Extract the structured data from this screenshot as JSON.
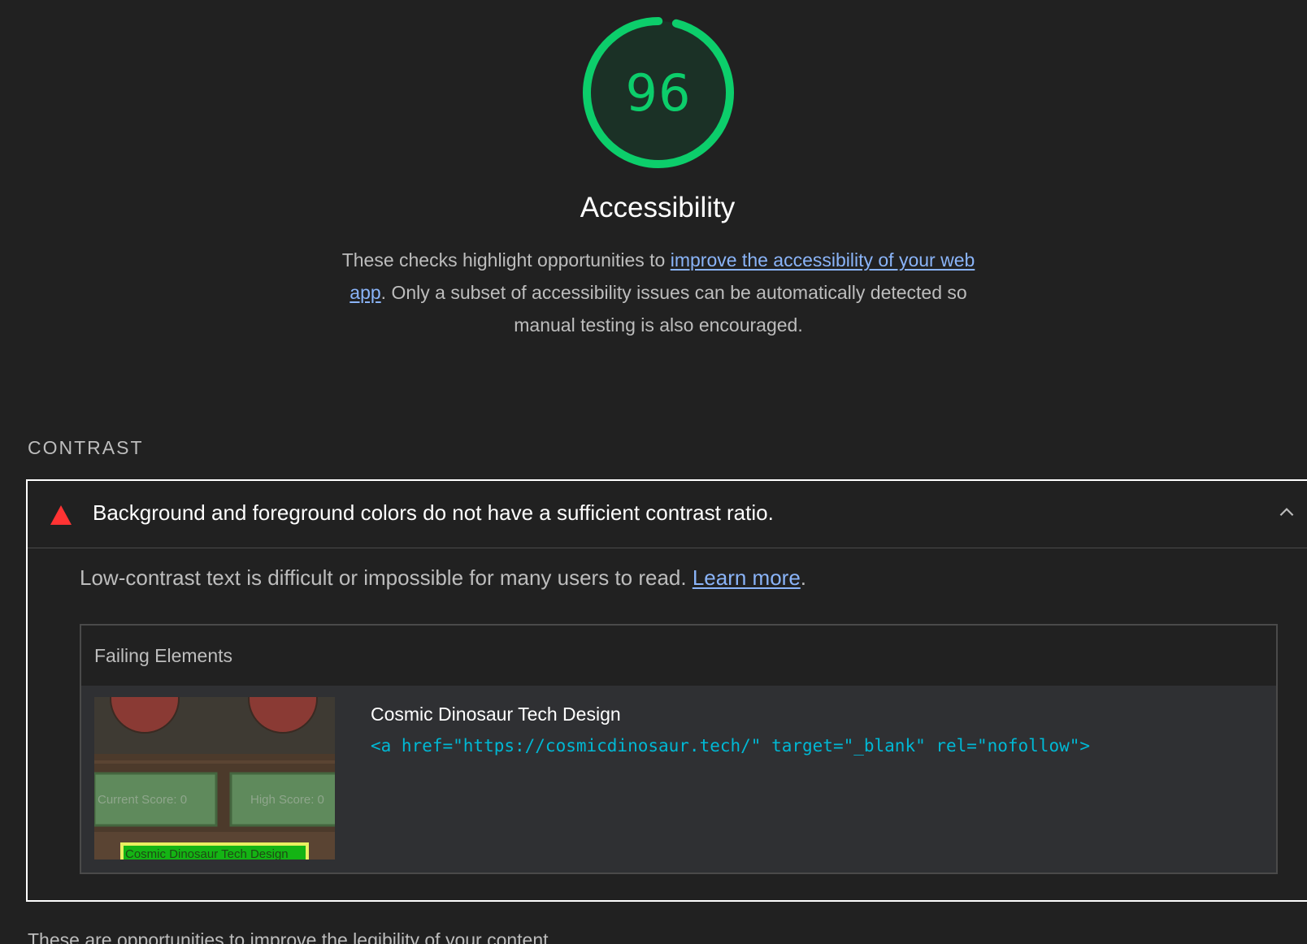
{
  "score": {
    "value": "96",
    "fraction": 0.96,
    "color": "#0cce6b"
  },
  "category": {
    "title": "Accessibility",
    "desc_before": "These checks highlight opportunities to ",
    "desc_link": "improve the accessibility of your web app",
    "desc_after": ". Only a subset of accessibility issues can be automatically detected so manual testing is also encouraged."
  },
  "group": {
    "title": "CONTRAST",
    "footer": "These are opportunities to improve the legibility of your content."
  },
  "audit": {
    "status_icon": "warning-triangle-icon",
    "status_color": "#ff3333",
    "title": "Background and foreground colors do not have a sufficient contrast ratio.",
    "desc_before": "Low-contrast text is difficult or impossible for many users to read. ",
    "desc_link": "Learn more",
    "desc_after": ".",
    "details_header": "Failing Elements",
    "node": {
      "label": "Cosmic Dinosaur Tech Design",
      "snippet": "<a href=\"https://cosmicdinosaur.tech/\" target=\"_blank\" rel=\"nofollow\">"
    },
    "screenshot": {
      "current_score": "Current Score: 0",
      "high_score": "High Score: 0",
      "highlight_text": "Cosmic Dinosaur Tech Design"
    }
  }
}
